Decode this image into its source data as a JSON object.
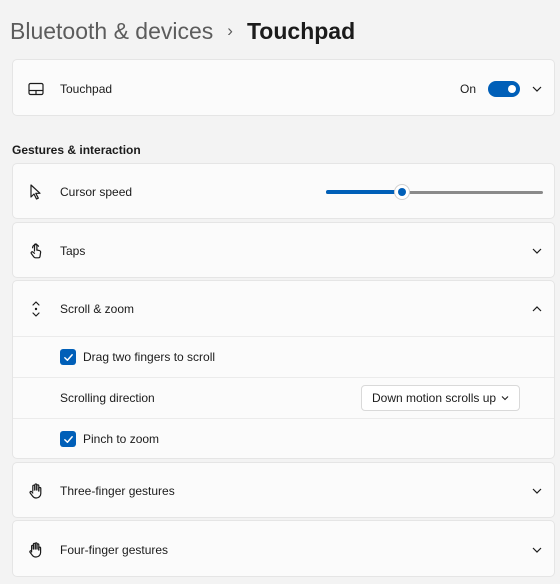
{
  "breadcrumb": {
    "parent": "Bluetooth & devices",
    "separator": "›",
    "current": "Touchpad"
  },
  "touchpad": {
    "label": "Touchpad",
    "toggle_state": "On",
    "icon": "touchpad-icon"
  },
  "section": {
    "title": "Gestures & interaction"
  },
  "cursor_speed": {
    "label": "Cursor speed",
    "value_fraction": 0.35,
    "icon": "cursor-icon"
  },
  "taps": {
    "label": "Taps",
    "icon": "tap-icon"
  },
  "scroll_zoom": {
    "label": "Scroll & zoom",
    "icon": "scroll-icon",
    "expanded": true,
    "drag_two_fingers": {
      "label": "Drag two fingers to scroll",
      "checked": true
    },
    "scrolling_direction": {
      "label": "Scrolling direction",
      "selected": "Down motion scrolls up"
    },
    "pinch_to_zoom": {
      "label": "Pinch to zoom",
      "checked": true
    }
  },
  "three_finger": {
    "label": "Three-finger gestures",
    "icon": "three-finger-hand-icon"
  },
  "four_finger": {
    "label": "Four-finger gestures",
    "icon": "four-finger-hand-icon"
  },
  "colors": {
    "accent": "#005fb8",
    "background": "#f3f3f3",
    "card": "#fbfbfb"
  }
}
